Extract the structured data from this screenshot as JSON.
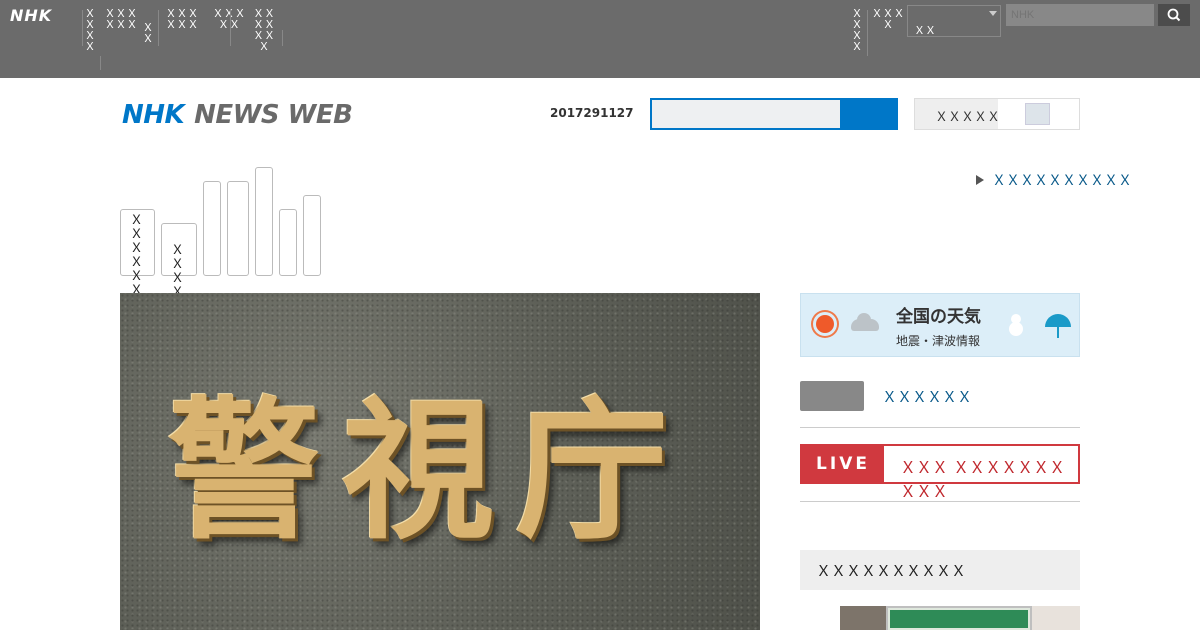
{
  "topbar": {
    "logo": "NHK",
    "nav_left": [
      "ＸＸＸＸ",
      "ＸＸＸＸＸＸ",
      "ＸＸ",
      "ＸＸＸＸＸＸ",
      "ＸＸＸＸＸ",
      "ＸＸＸＸＸＸＸ"
    ],
    "nav_right": [
      "ＸＸＸＸ",
      "ＸＸＸＸ"
    ],
    "region_select": "ＸＸ",
    "search_placeholder": "NHK"
  },
  "header": {
    "logo_nhk": "NHK",
    "logo_text": "NEWS WEB",
    "date": "2017291127",
    "text_size_label": "ＸＸＸＸＸ"
  },
  "subnav": {
    "tabs": [
      "ＸＸＸＸＸＸＸＸ",
      "ＸＸＸＸ",
      "",
      "",
      "",
      "",
      ""
    ],
    "all_news_link": "ＸＸＸＸＸＸＸＸＸＸ"
  },
  "hero": {
    "sign_text": "警視庁"
  },
  "sidebar": {
    "weather_title": "全国の天気",
    "weather_sub": "地震・津波情報",
    "special_link": "ＸＸＸＸＸＸ",
    "live_label": "LIVE",
    "live_text": "ＸＸＸ ＸＸＸＸＸＸＸＸＸＸ",
    "ranking_heading": "ＸＸＸＸＸＸＸＸＸＸ"
  },
  "colors": {
    "accent_blue": "#0077c8",
    "live_red": "#d0393f",
    "topbar_gray": "#6b6b6b"
  },
  "icons": [
    "search-icon",
    "sun-icon",
    "cloud-icon",
    "snowman-icon",
    "umbrella-icon",
    "chevron-down-icon"
  ]
}
